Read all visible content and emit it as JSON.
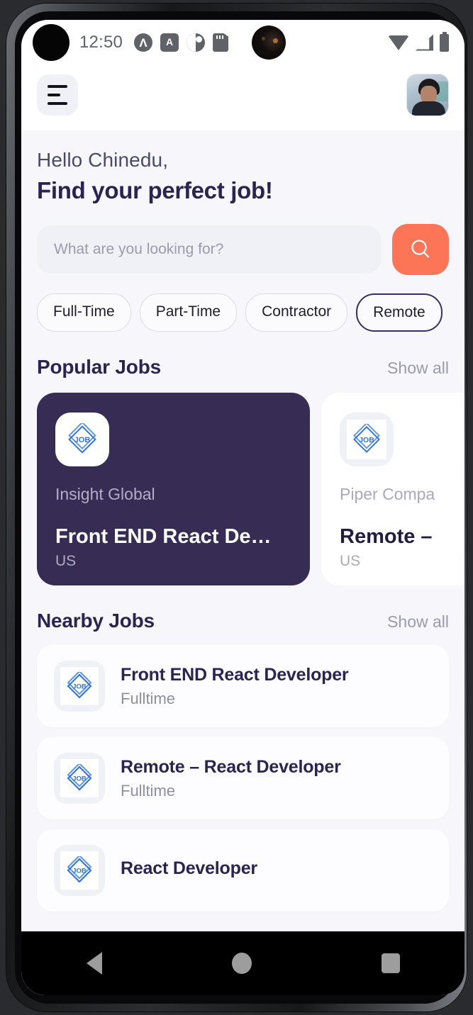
{
  "statusbar": {
    "time": "12:50",
    "icons": [
      "circle-a-icon",
      "a-badge-icon",
      "pie-circle-icon",
      "sd-card-icon",
      "camera-punch-hole-icon"
    ],
    "right_icons": [
      "wifi-icon",
      "cellular-signal-icon",
      "battery-icon"
    ]
  },
  "header": {
    "menu_icon": "hamburger-menu-icon",
    "avatar_alt": "user-avatar"
  },
  "greeting": {
    "hello": "Hello Chinedu,",
    "headline": "Find your perfect job!"
  },
  "search": {
    "placeholder": "What are you looking for?",
    "value": "",
    "button_icon": "search-icon",
    "button_color": "#fb7556"
  },
  "filters": [
    {
      "label": "Full-Time",
      "selected": false
    },
    {
      "label": "Part-Time",
      "selected": false
    },
    {
      "label": "Contractor",
      "selected": false
    },
    {
      "label": "Remote",
      "selected": true
    }
  ],
  "popular": {
    "title": "Popular Jobs",
    "show_all": "Show all",
    "cards": [
      {
        "company": "Insight Global",
        "title": "Front END React De…",
        "location": "US",
        "logo": "job-diamond-logo-icon",
        "theme": "dark"
      },
      {
        "company": "Piper Compa",
        "title": "Remote –",
        "location": "US",
        "logo": "job-diamond-logo-icon",
        "theme": "light"
      }
    ]
  },
  "nearby": {
    "title": "Nearby Jobs",
    "show_all": "Show all",
    "items": [
      {
        "title": "Front END React Developer",
        "type": "Fulltime",
        "logo": "job-diamond-logo-icon"
      },
      {
        "title": "Remote – React Developer",
        "type": "Fulltime",
        "logo": "job-diamond-logo-icon"
      },
      {
        "title": "React Developer",
        "type": "",
        "logo": "job-diamond-logo-icon"
      }
    ]
  },
  "android_nav": {
    "back": "back-button",
    "home": "home-button",
    "recents": "recents-button"
  },
  "colors": {
    "accent_orange": "#fb7556",
    "dark_card": "#372c54",
    "heading": "#2b2450",
    "logo_blue": "#2f74e0",
    "page_bg": "#f7f7fb"
  }
}
